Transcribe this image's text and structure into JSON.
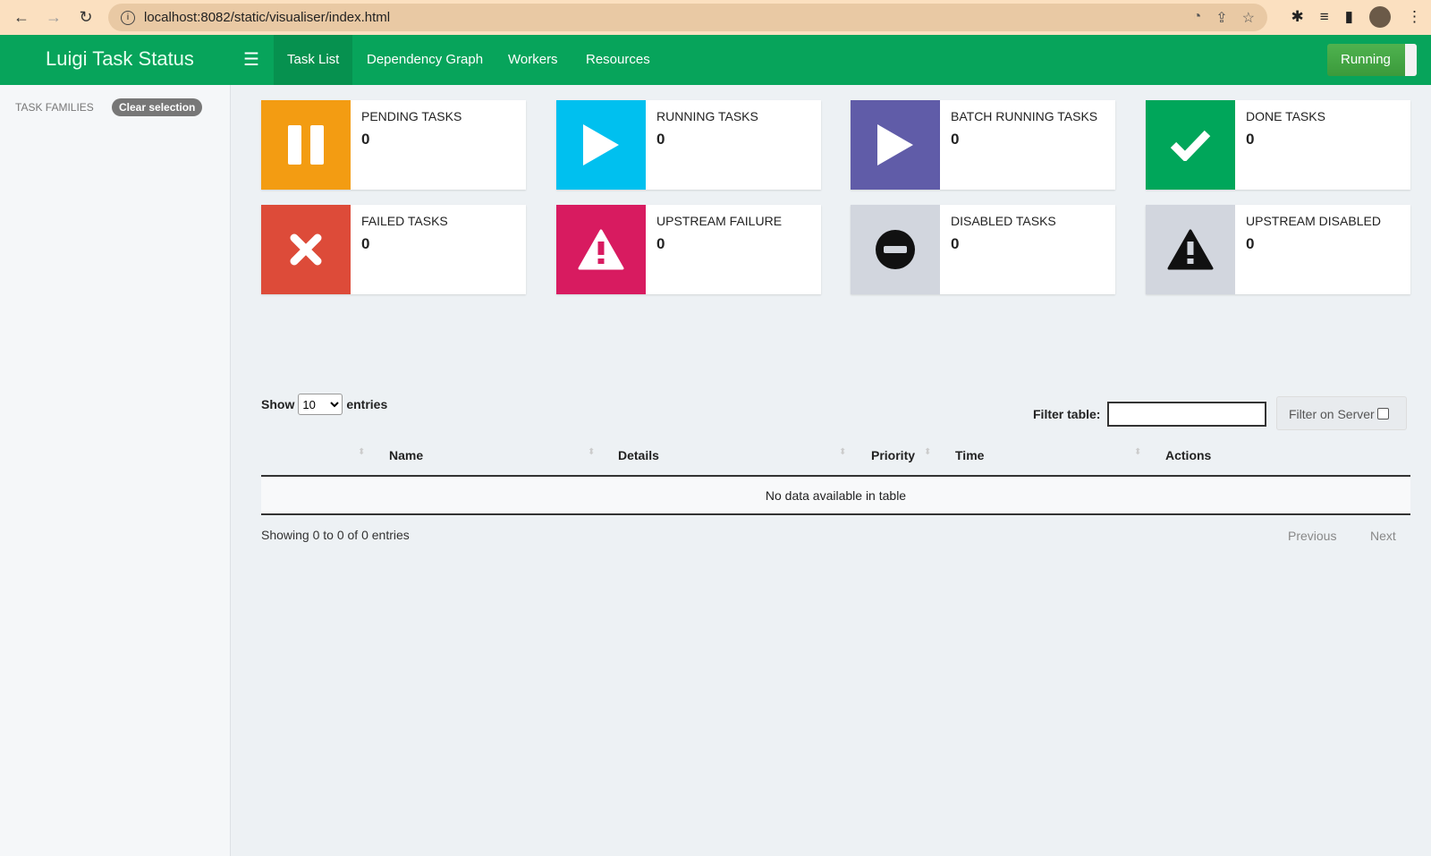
{
  "browser": {
    "url": "localhost:8082/static/visualiser/index.html"
  },
  "navbar": {
    "brand": "Luigi Task Status",
    "tabs": [
      {
        "label": "Task List",
        "active": true
      },
      {
        "label": "Dependency Graph"
      },
      {
        "label": "Workers"
      },
      {
        "label": "Resources"
      }
    ],
    "status_button": "Running"
  },
  "sidebar": {
    "title": "TASK FAMILIES",
    "clear_label": "Clear selection"
  },
  "cards": [
    {
      "title": "PENDING TASKS",
      "value": "0",
      "color": "#f39c12",
      "icon": "pause-icon"
    },
    {
      "title": "RUNNING TASKS",
      "value": "0",
      "color": "#00c0ef",
      "icon": "play-icon"
    },
    {
      "title": "BATCH RUNNING TASKS",
      "value": "0",
      "color": "#605ca8",
      "icon": "play-icon"
    },
    {
      "title": "DONE TASKS",
      "value": "0",
      "color": "#00a65a",
      "icon": "check-icon"
    },
    {
      "title": "FAILED TASKS",
      "value": "0",
      "color": "#dd4b39",
      "icon": "times-icon"
    },
    {
      "title": "UPSTREAM FAILURE",
      "value": "0",
      "color": "#d81b60",
      "icon": "warning-icon"
    },
    {
      "title": "DISABLED TASKS",
      "value": "0",
      "color": "#d2d6de",
      "icon": "minus-circle-icon"
    },
    {
      "title": "UPSTREAM DISABLED",
      "value": "0",
      "color": "#d2d6de",
      "icon": "warning-icon"
    }
  ],
  "table": {
    "show_label": "Show",
    "entries_value": "10",
    "entries_label": "entries",
    "filter_label": "Filter table:",
    "filter_value": "",
    "filter_server_label": "Filter on Server",
    "columns": [
      "Name",
      "Details",
      "Priority",
      "Time",
      "Actions"
    ],
    "empty": "No data available in table",
    "info": "Showing 0 to 0 of 0 entries",
    "previous": "Previous",
    "next": "Next"
  }
}
